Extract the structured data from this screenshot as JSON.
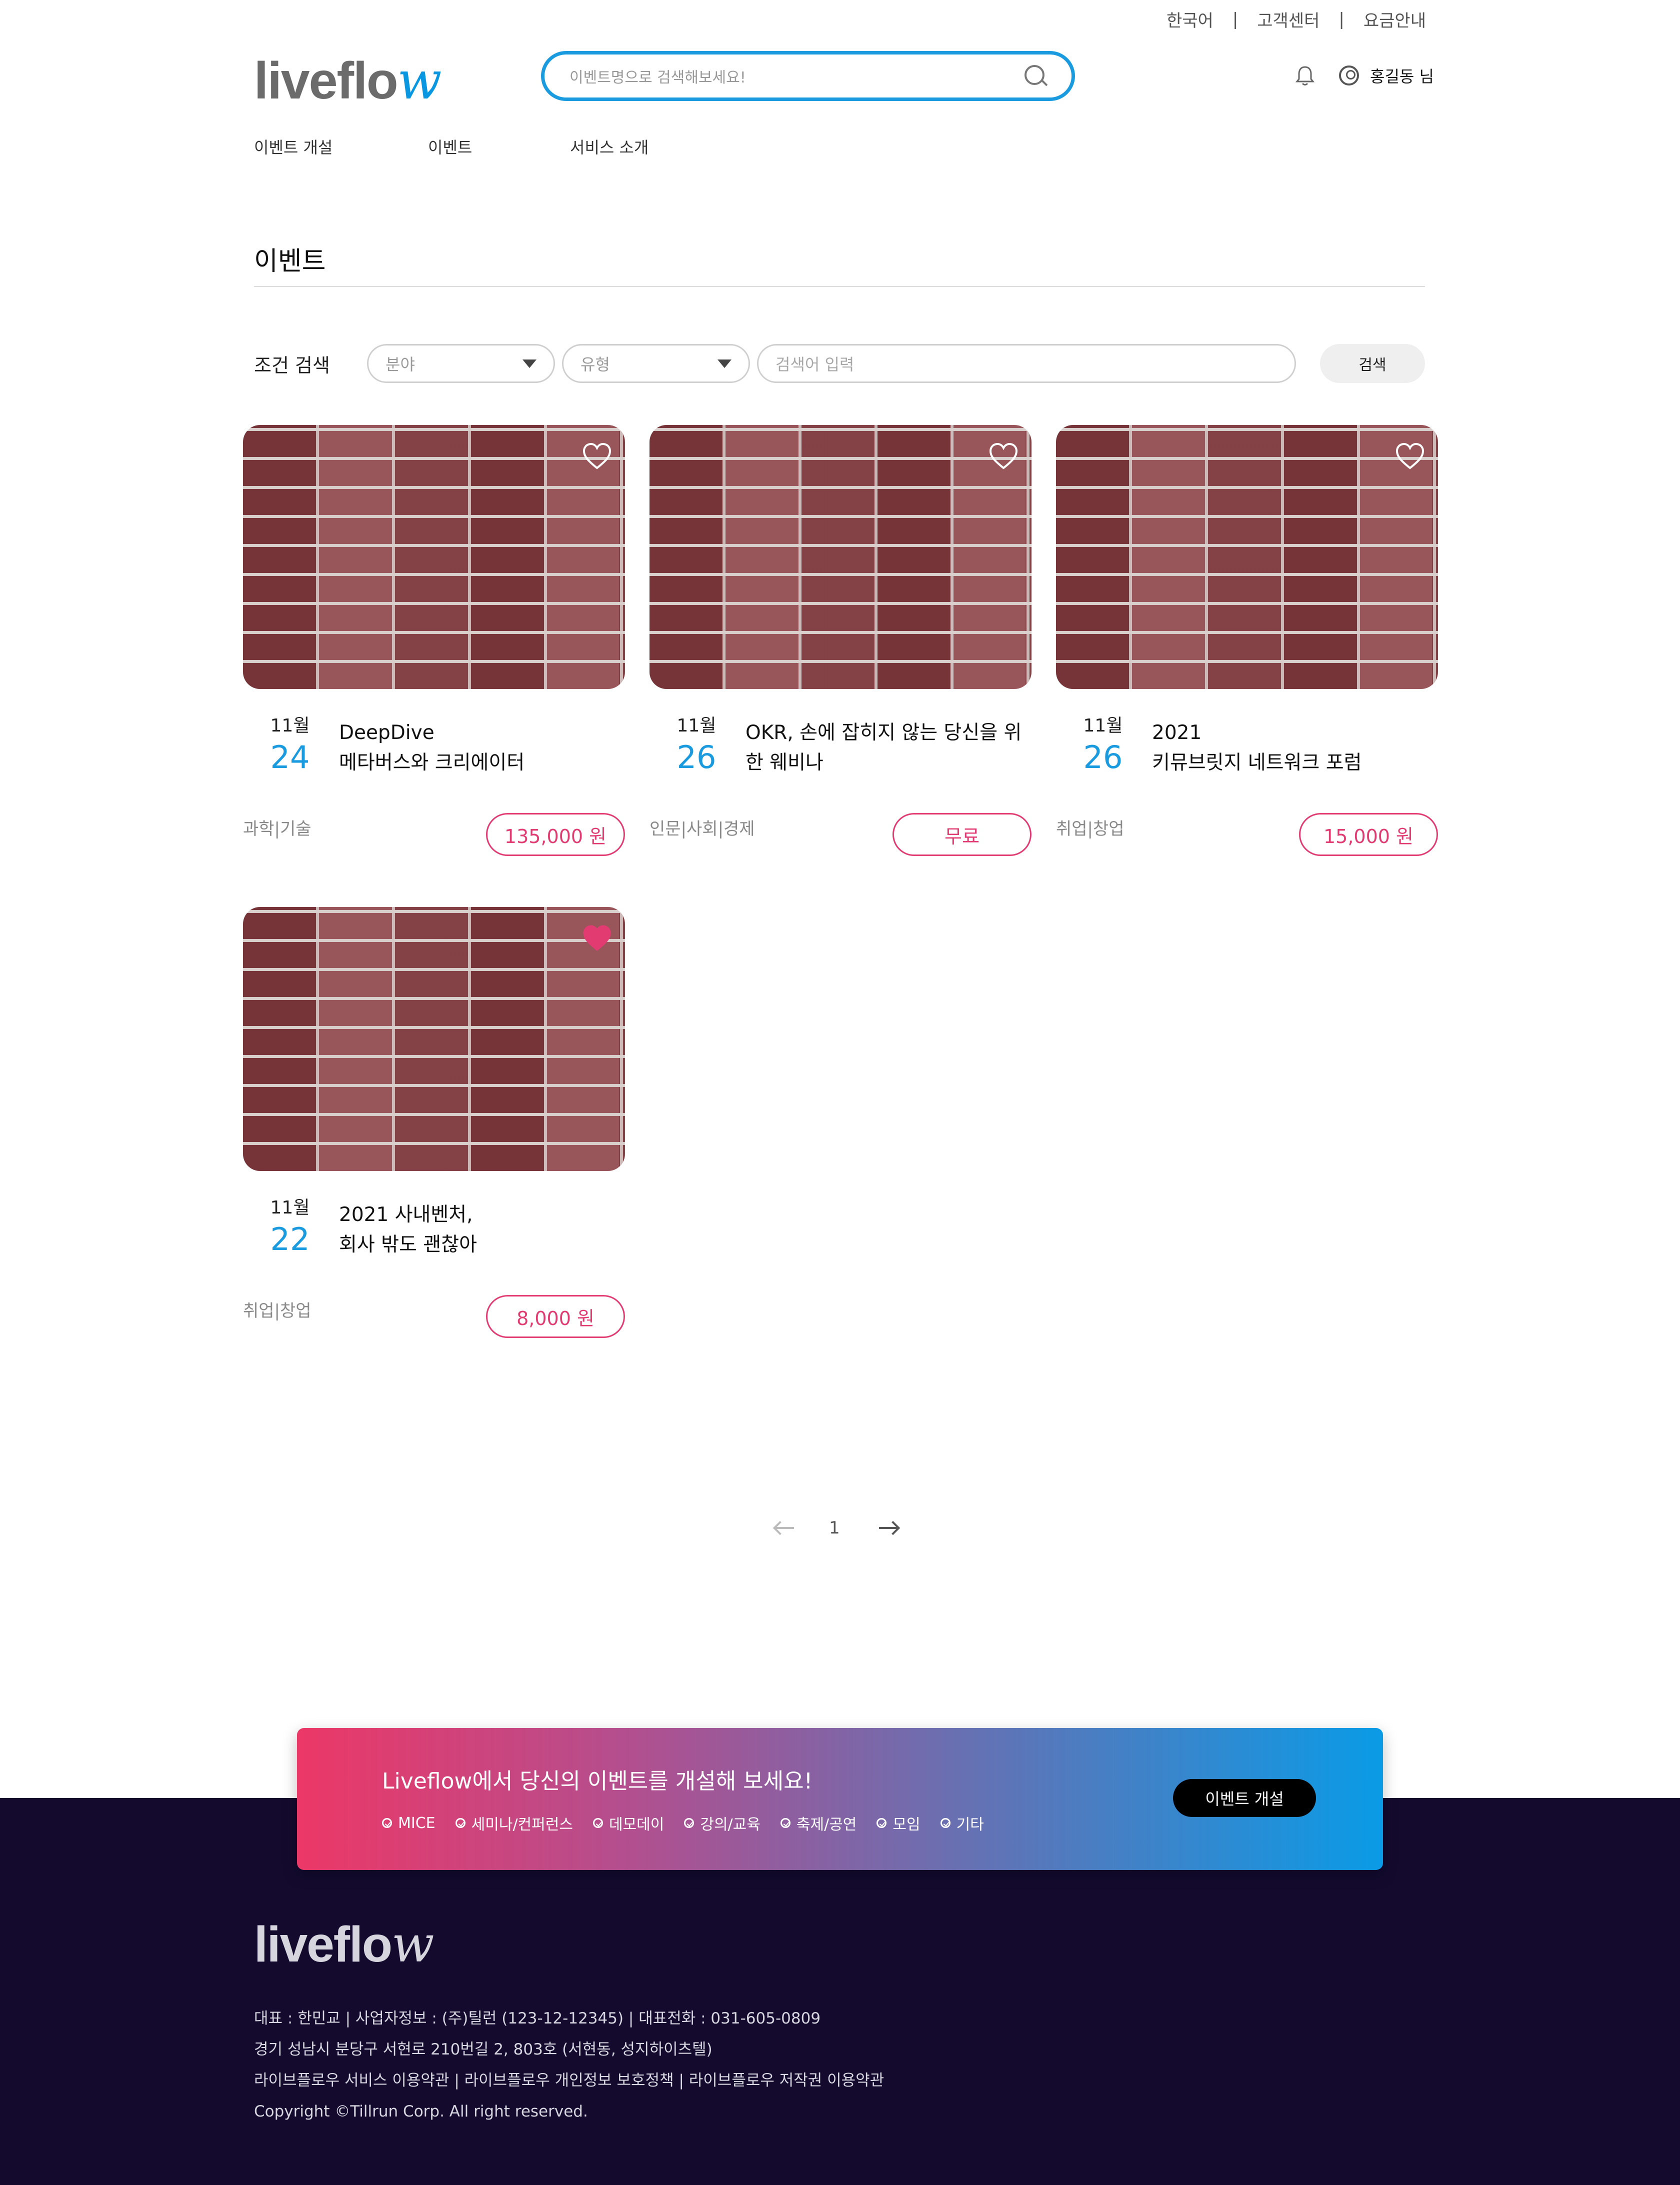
{
  "util_links": [
    "한국어",
    "고객센터",
    "요금안내"
  ],
  "header": {
    "logo_a": "liveflo",
    "logo_b": "w",
    "search_placeholder": "이벤트명으로 검색해보세요!",
    "user_name": "홍길동 님"
  },
  "nav": [
    "이벤트 개설",
    "이벤트",
    "서비스 소개"
  ],
  "page_title": "이벤트",
  "filter": {
    "label": "조건 검색",
    "field_select": "분야",
    "type_select": "유형",
    "keyword_placeholder": "검색어 입력",
    "search_button": "검색"
  },
  "events": [
    {
      "month": "11월",
      "day": "24",
      "title": "DeepDive\n메타버스와 크리에이터",
      "category": "과학|기술",
      "price": "135,000 원",
      "liked": false
    },
    {
      "month": "11월",
      "day": "26",
      "title": "OKR, 손에 잡히지 않는 당신을 위한 웨비나",
      "category": "인문|사회|경제",
      "price": "무료",
      "liked": false
    },
    {
      "month": "11월",
      "day": "26",
      "title": "2021\n키뮤브릿지 네트워크 포럼",
      "category": "취업|창업",
      "price": "15,000 원",
      "liked": false
    },
    {
      "month": "11월",
      "day": "22",
      "title": "2021 사내벤처,\n회사 밖도 괜찮아",
      "category": "취업|창업",
      "price": "8,000 원",
      "liked": true
    }
  ],
  "pagination": {
    "current": "1"
  },
  "banner": {
    "title": "Liveflow에서 당신의 이벤트를 개설해 보세요!",
    "chips": [
      "MICE",
      "세미나/컨퍼런스",
      "데모데이",
      "강의/교육",
      "축제/공연",
      "모임",
      "기타"
    ],
    "button": "이벤트 개설"
  },
  "footer": {
    "logo_a": "liveflo",
    "logo_b": "w",
    "lines": [
      "대표 : 한민교 | 사업자정보 : (주)틸런 (123-12-12345) | 대표전화 : 031-605-0809",
      "경기 성남시 분당구 서현로 210번길 2, 803호 (서현동, 성지하이츠텔)",
      "라이브플로우 서비스 이용약관 | 라이브플로우 개인정보 보호정책 | 라이브플로우 저작권 이용약관",
      "Copyright ©Tillrun Corp. All right reserved."
    ]
  },
  "colors": {
    "accent": "#1a9be0",
    "price": "#e13b72",
    "footer_bg": "#130a2e"
  },
  "icons": [
    "search-icon",
    "bell-icon",
    "user-icon",
    "heart-icon",
    "caret-down-icon",
    "arrow-left-icon",
    "arrow-right-icon",
    "check-circle-icon"
  ]
}
